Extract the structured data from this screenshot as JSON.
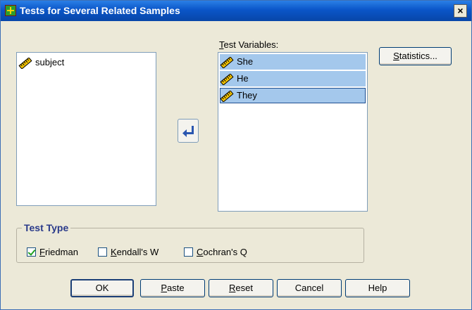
{
  "window": {
    "title": "Tests for Several Related Samples",
    "close_label": "×"
  },
  "source_list": {
    "items": [
      {
        "label": "subject",
        "icon": "ruler-icon"
      }
    ]
  },
  "test_variables": {
    "heading_prefix": "",
    "heading_underlined": "T",
    "heading_rest": "est Variables:",
    "items": [
      {
        "label": "She",
        "icon": "ruler-icon",
        "selected": true
      },
      {
        "label": "He",
        "icon": "ruler-icon",
        "selected": true
      },
      {
        "label": "They",
        "icon": "ruler-icon",
        "selected": true,
        "focused": true
      }
    ]
  },
  "statistics_button": {
    "underlined": "S",
    "rest": "tatistics..."
  },
  "move_button": {
    "icon": "arrow-left-icon"
  },
  "test_type": {
    "title": "Test Type",
    "options": [
      {
        "underlined": "F",
        "rest": "riedman",
        "checked": true
      },
      {
        "underlined": "K",
        "rest": "endall's W",
        "checked": false
      },
      {
        "underlined": "C",
        "rest": "ochran's Q",
        "checked": false
      }
    ]
  },
  "buttons": {
    "ok": "OK",
    "paste_u": "P",
    "paste_rest": "aste",
    "reset_u": "R",
    "reset_rest": "eset",
    "cancel": "Cancel",
    "help": "Help"
  },
  "colors": {
    "titlebar": "#0a55c8",
    "dialog_bg": "#ece9d8",
    "selection": "#a4c8ec",
    "group_title": "#2a3a8a"
  }
}
